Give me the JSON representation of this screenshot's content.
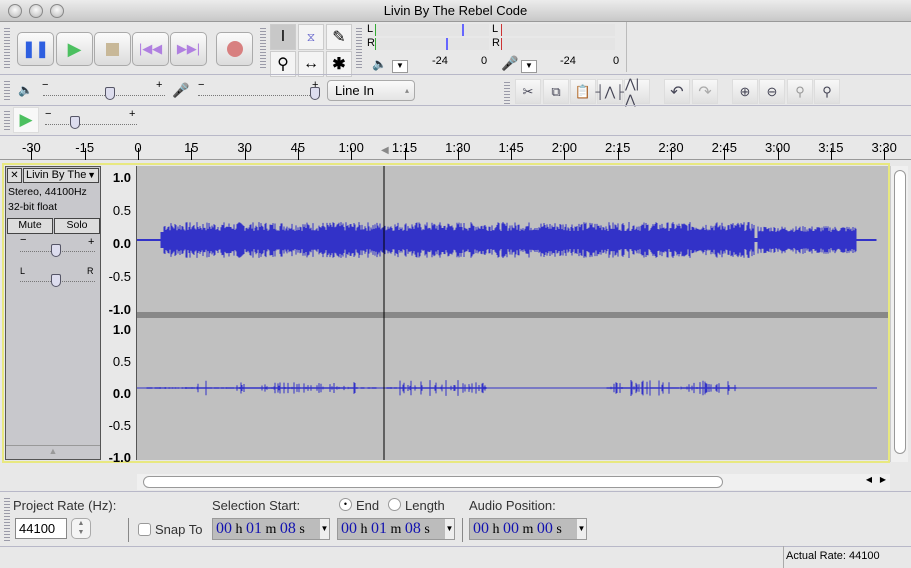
{
  "window": {
    "title": "Livin By The Rebel Code"
  },
  "meter": {
    "play_ticks": [
      "-24",
      "0"
    ],
    "rec_ticks": [
      "-24",
      "0"
    ],
    "left": "L",
    "right": "R"
  },
  "mixer": {
    "input_source": "Line In",
    "minus": "−",
    "plus": "+"
  },
  "ruler": {
    "labels": [
      "-30",
      "-15",
      "0",
      "15",
      "30",
      "45",
      "1:00",
      "1:15",
      "1:30",
      "1:45",
      "2:00",
      "2:15",
      "2:30",
      "2:45",
      "3:00",
      "3:15",
      "3:30"
    ]
  },
  "track": {
    "name": "Livin By The",
    "info1": "Stereo, 44100Hz",
    "info2": "32-bit float",
    "mute": "Mute",
    "solo": "Solo",
    "gain_minus": "−",
    "gain_plus": "+",
    "pan_left": "L",
    "pan_right": "R",
    "close": "✕"
  },
  "vruler": [
    "1.0",
    "0.5",
    "0.0",
    "-0.5",
    "-1.0"
  ],
  "selection_bar": {
    "project_rate_label": "Project Rate (Hz):",
    "project_rate": "44100",
    "snap_to": "Snap To",
    "selection_start_label": "Selection Start:",
    "end_label": "End",
    "length_label": "Length",
    "audio_position_label": "Audio Position:",
    "start": {
      "h": "00",
      "m": "01",
      "s": "08"
    },
    "end": {
      "h": "00",
      "m": "01",
      "s": "08"
    },
    "position": {
      "h": "00",
      "m": "00",
      "s": "00"
    },
    "unit_h": "h",
    "unit_m": "m",
    "unit_s": "s"
  },
  "status": {
    "actual_rate": "Actual Rate: 44100"
  },
  "colors": {
    "wave": "#3232c8",
    "track_bg": "#c0c0c0",
    "selected_border": "#e8e880"
  }
}
